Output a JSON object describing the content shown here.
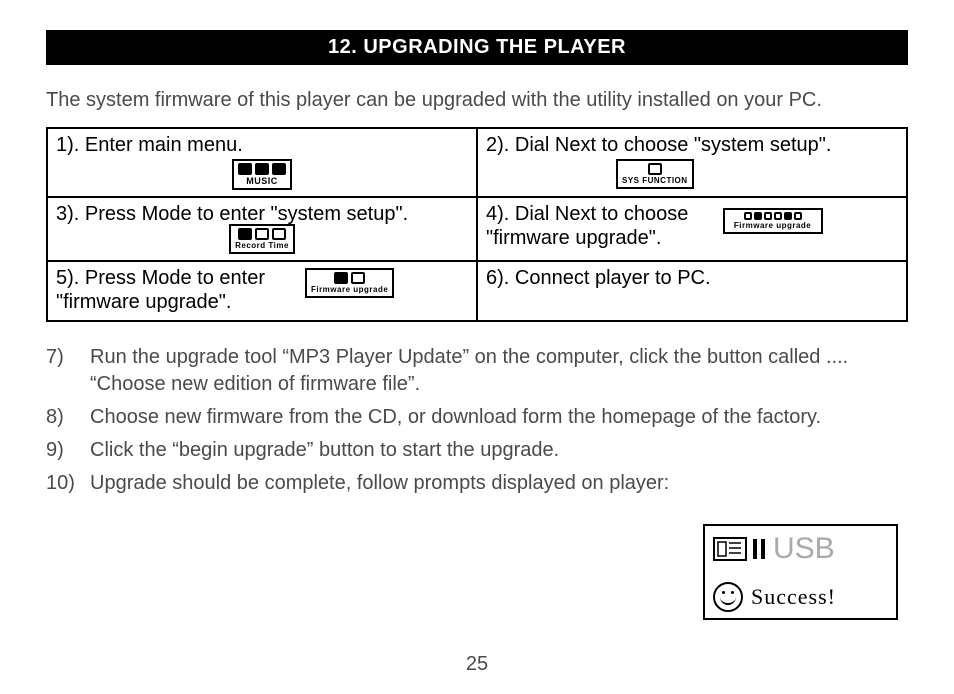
{
  "heading": "12. UPGRADING THE PLAYER",
  "intro": "The system firmware of this player can be upgraded with the utility installed on your PC.",
  "table": {
    "r1c1": {
      "text": "1). Enter main menu.",
      "lcd_label": "MUSIC"
    },
    "r1c2": {
      "text": "2). Dial Next to choose \"system setup\".",
      "lcd_label": "SYS FUNCTION"
    },
    "r2c1": {
      "text": "3). Press Mode to enter \"system setup\".",
      "lcd_label": "Record Time"
    },
    "r2c2": {
      "text": "4). Dial Next to choose \"firmware upgrade\".",
      "lcd_label": "Firmware upgrade"
    },
    "r3c1": {
      "text": "5). Press Mode to enter \"firmware upgrade\".",
      "lcd_label": "Firmware upgrade"
    },
    "r3c2": {
      "text": "6). Connect player to PC."
    }
  },
  "list": {
    "i7": {
      "num": "7)",
      "text": "Run the upgrade tool “MP3 Player Update” on the computer, click the button called .... “Choose new edition of firmware file”."
    },
    "i8": {
      "num": "8)",
      "text": "Choose new firmware from the CD, or download form the homepage of the factory."
    },
    "i9": {
      "num": "9)",
      "text": "Click the “begin upgrade” button to start the upgrade."
    },
    "i10": {
      "num": "10)",
      "text": "Upgrade should be complete, follow prompts displayed on player:"
    }
  },
  "success": {
    "usb": "USB",
    "text": "Success!"
  },
  "page_number": "25"
}
